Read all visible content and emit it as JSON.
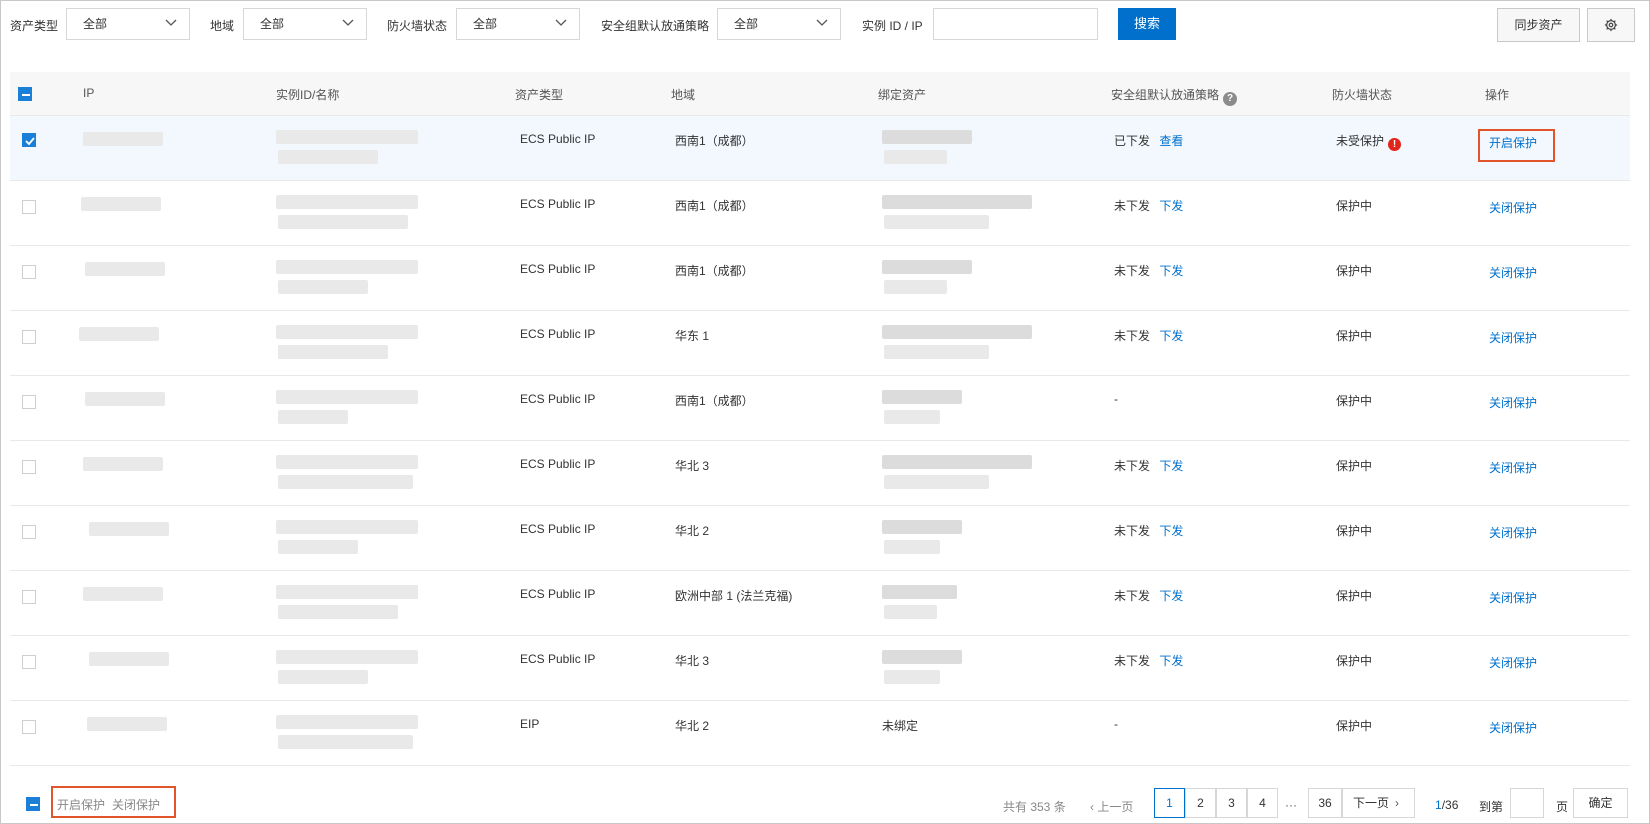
{
  "filters": {
    "asset_type_label": "资产类型",
    "asset_type_value": "全部",
    "region_label": "地域",
    "region_value": "全部",
    "firewall_label": "防火墙状态",
    "firewall_value": "全部",
    "sg_policy_label": "安全组默认放通策略",
    "sg_policy_value": "全部",
    "instance_label": "实例 ID / IP",
    "instance_placeholder": "",
    "search_button": "搜索",
    "sync_button": "同步资产"
  },
  "table": {
    "headers": {
      "ip": "IP",
      "instance": "实例ID/名称",
      "asset_type": "资产类型",
      "region": "地域",
      "bound_asset": "绑定资产",
      "sg_policy": "安全组默认放通策略",
      "firewall": "防火墙状态",
      "action": "操作"
    },
    "rows": [
      {
        "checked": true,
        "asset_type": "ECS Public IP",
        "region": "西南1（成都）",
        "sg_status": "已下发",
        "sg_action": "查看",
        "bound": "",
        "firewall": "未受保护",
        "firewall_warning": true,
        "action": "开启保护"
      },
      {
        "checked": false,
        "asset_type": "ECS Public IP",
        "region": "西南1（成都）",
        "sg_status": "未下发",
        "sg_action": "下发",
        "bound": "",
        "firewall": "保护中",
        "firewall_warning": false,
        "action": "关闭保护"
      },
      {
        "checked": false,
        "asset_type": "ECS Public IP",
        "region": "西南1（成都）",
        "sg_status": "未下发",
        "sg_action": "下发",
        "bound": "",
        "firewall": "保护中",
        "firewall_warning": false,
        "action": "关闭保护"
      },
      {
        "checked": false,
        "asset_type": "ECS Public IP",
        "region": "华东 1",
        "sg_status": "未下发",
        "sg_action": "下发",
        "bound": "",
        "firewall": "保护中",
        "firewall_warning": false,
        "action": "关闭保护"
      },
      {
        "checked": false,
        "asset_type": "ECS Public IP",
        "region": "西南1（成都）",
        "sg_status": "-",
        "sg_action": "",
        "bound": "",
        "firewall": "保护中",
        "firewall_warning": false,
        "action": "关闭保护"
      },
      {
        "checked": false,
        "asset_type": "ECS Public IP",
        "region": "华北 3",
        "sg_status": "未下发",
        "sg_action": "下发",
        "bound": "",
        "firewall": "保护中",
        "firewall_warning": false,
        "action": "关闭保护"
      },
      {
        "checked": false,
        "asset_type": "ECS Public IP",
        "region": "华北 2",
        "sg_status": "未下发",
        "sg_action": "下发",
        "bound": "",
        "firewall": "保护中",
        "firewall_warning": false,
        "action": "关闭保护"
      },
      {
        "checked": false,
        "asset_type": "ECS Public IP",
        "region": "欧洲中部 1 (法兰克福)",
        "sg_status": "未下发",
        "sg_action": "下发",
        "bound": "",
        "firewall": "保护中",
        "firewall_warning": false,
        "action": "关闭保护"
      },
      {
        "checked": false,
        "asset_type": "ECS Public IP",
        "region": "华北 3",
        "sg_status": "未下发",
        "sg_action": "下发",
        "bound": "",
        "firewall": "保护中",
        "firewall_warning": false,
        "action": "关闭保护"
      },
      {
        "checked": false,
        "asset_type": "EIP",
        "region": "华北 2",
        "sg_status": "-",
        "sg_action": "",
        "bound": "未绑定",
        "firewall": "保护中",
        "firewall_warning": false,
        "action": "关闭保护"
      }
    ]
  },
  "footer": {
    "batch_enable": "开启保护",
    "batch_disable": "关闭保护",
    "total": "共有 353 条",
    "prev": "上一页",
    "pages": [
      "1",
      "2",
      "3",
      "4"
    ],
    "ellipsis": "···",
    "last_page": "36",
    "next": "下一页",
    "current_page": "1",
    "page_total": "/36",
    "goto_label": "到第",
    "page_unit": "页",
    "confirm": "确定"
  },
  "colors": {
    "primary": "#0070cc",
    "highlight_box": "#e2552b",
    "warning": "#e1251b",
    "selected_row": "#f2f8fe"
  }
}
